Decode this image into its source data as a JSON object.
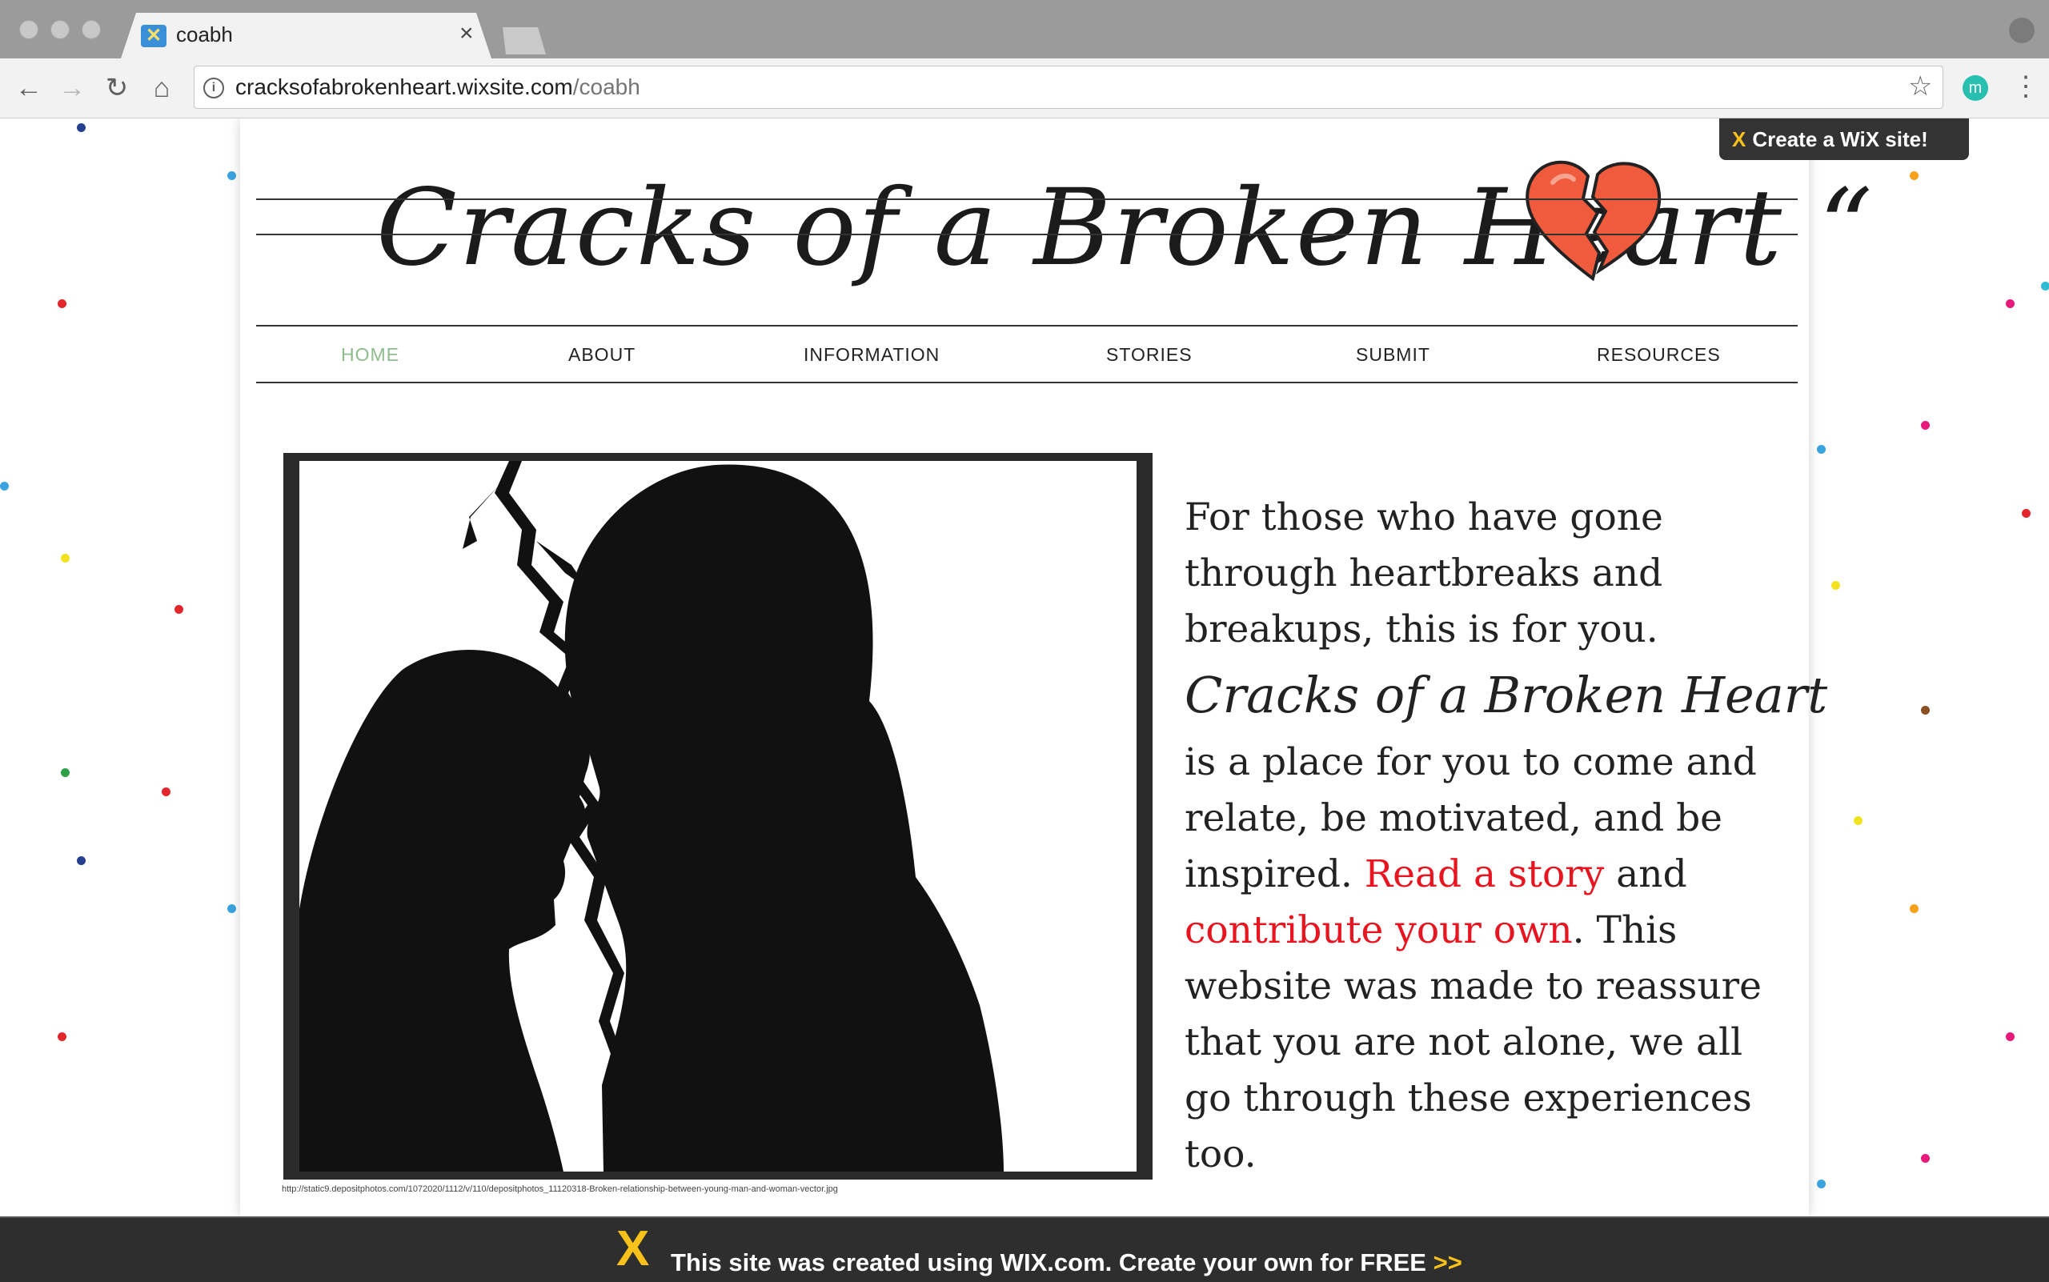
{
  "browser": {
    "tab_title": "coabh",
    "tab_close": "×",
    "url_host": "cracksofabrokenheart.wixsite.com",
    "url_path": "/coabh",
    "extension_label": "m"
  },
  "header": {
    "site_title": "Cracks of a Broken Heart",
    "quote_mark": "“"
  },
  "nav": {
    "items": [
      {
        "label": "HOME",
        "active": true
      },
      {
        "label": "ABOUT"
      },
      {
        "label": "INFORMATION"
      },
      {
        "label": "STORIES"
      },
      {
        "label": "SUBMIT"
      },
      {
        "label": "RESOURCES"
      }
    ]
  },
  "main": {
    "image_credit": "http://static9.depositphotos.com/1072020/1112/v/110/depositphotos_11120318-Broken-relationship-between-young-man-and-woman-vector.jpg",
    "intro_line": "For those who have gone through heartbreaks and breakups, this is for you.",
    "brand_name": "Cracks of a Broken Heart",
    "body_start": "is a place for you to come and relate, be motivated, and be inspired. ",
    "link_story": "Read a story",
    "and_text": " and ",
    "link_contribute": "contribute your own",
    "body_end": ". This website was made to reassure that you are not alone, we all go through these experiences too."
  },
  "wix": {
    "badge_text": "Create a WiX site!",
    "badge_logo": "X",
    "bar_logo": "X",
    "bar_text": "This site was created using WIX.com. Create your own for FREE ",
    "bar_arrows": ">>"
  },
  "icons": {
    "back": "back-arrow-icon",
    "forward": "forward-arrow-icon",
    "reload": "reload-icon",
    "home": "home-icon",
    "info": "info-icon",
    "star": "star-icon",
    "menu": "more-menu-icon",
    "heart": "broken-heart-icon"
  },
  "colors": {
    "link": "#e8141f",
    "nav_active": "#8dbc8d",
    "heart": "#ef5b3c",
    "wix_yellow": "#f8c21a"
  }
}
